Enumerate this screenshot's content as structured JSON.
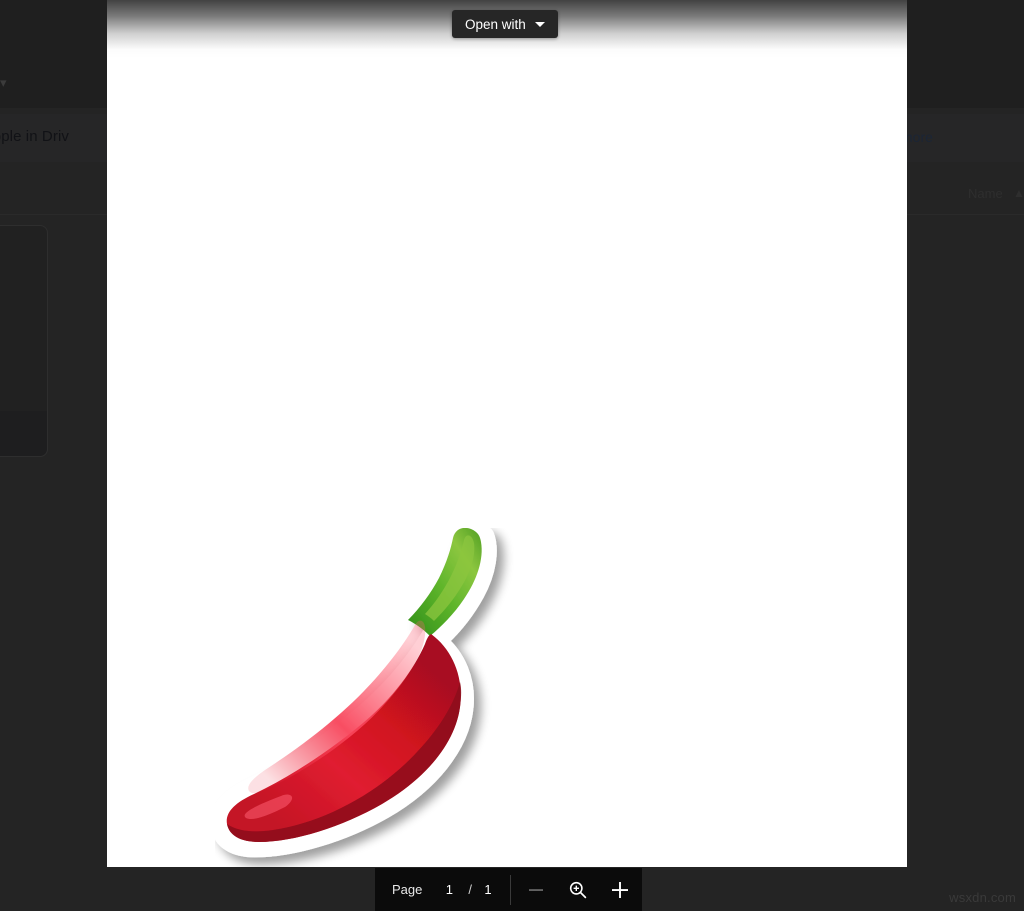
{
  "background": {
    "banner_text": "k people in Driv",
    "banner_link": "more",
    "column_name": "Name",
    "sort_icon": "arrow-up-icon",
    "caret_icon": "caret-icon",
    "watermark": "wsxdn.com"
  },
  "viewer": {
    "open_with_label": "Open with",
    "open_with_caret_icon": "chevron-down-icon",
    "document": {
      "type": "image",
      "subject": "red chili pepper sticker",
      "colors": {
        "pepper_light": "#ef2233",
        "pepper_mid": "#d61427",
        "pepper_dark": "#9e0f1c",
        "stem_light": "#8cc63f",
        "stem_mid": "#4ca524",
        "stem_dark": "#2f8f18",
        "outline": "#ffffff",
        "page": "#ffffff"
      }
    }
  },
  "toolbar": {
    "page_label": "Page",
    "page_current": "1",
    "page_separator": "/",
    "page_total": "1",
    "zoom_out_icon": "minus-icon",
    "zoom_reset_icon": "magnifier-plus-icon",
    "zoom_in_icon": "plus-icon",
    "zoom_out_disabled": true
  }
}
